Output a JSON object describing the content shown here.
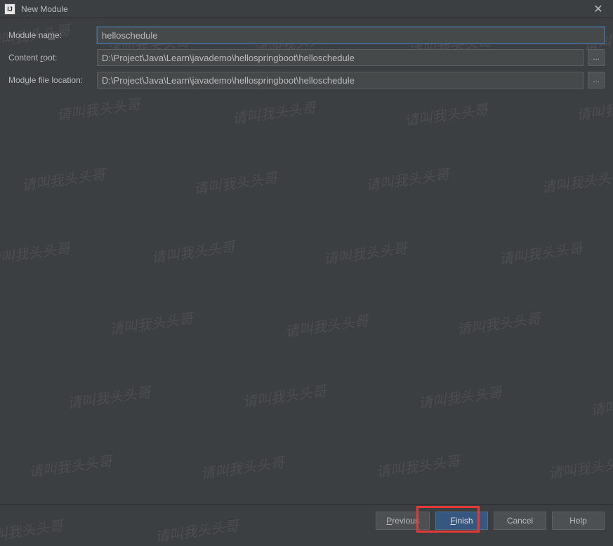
{
  "titlebar": {
    "title": "New Module",
    "icon_text": "IJ"
  },
  "form": {
    "module_name": {
      "label_pre": "Module na",
      "label_m": "m",
      "label_post": "e:",
      "value": "helloschedule"
    },
    "content_root": {
      "label_pre": "Content ",
      "label_m": "r",
      "label_post": "oot:",
      "value": "D:\\Project\\Java\\Learn\\javademo\\hellospringboot\\helloschedule",
      "browse": "..."
    },
    "module_file_location": {
      "label_pre": "Mod",
      "label_m": "u",
      "label_post": "le file location:",
      "value": "D:\\Project\\Java\\Learn\\javademo\\hellospringboot\\helloschedule",
      "browse": "..."
    }
  },
  "buttons": {
    "previous": {
      "pre": "",
      "m": "P",
      "post": "revious"
    },
    "finish": {
      "pre": "",
      "m": "F",
      "post": "inish"
    },
    "cancel": "Cancel",
    "help": "Help"
  },
  "watermark_text": "请叫我头头哥"
}
